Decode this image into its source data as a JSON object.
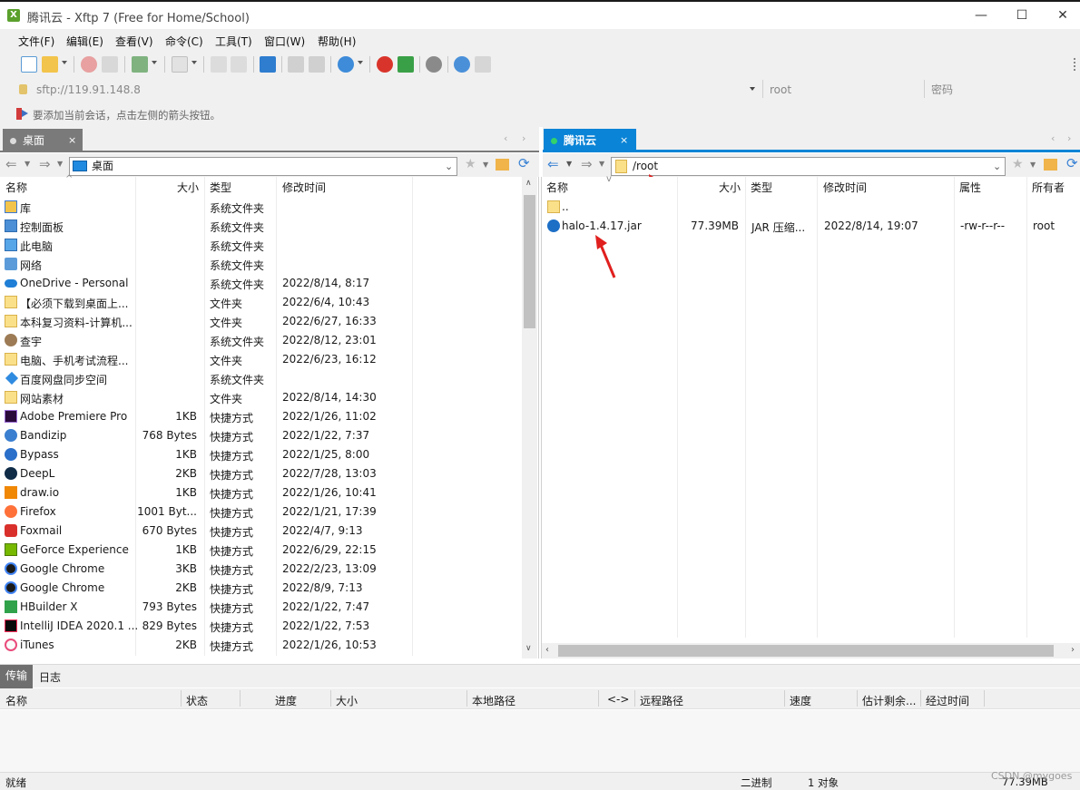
{
  "window": {
    "title": "腾讯云 - Xftp 7 (Free for Home/School)",
    "minimize": "—",
    "maximize": "☐",
    "close": "✕"
  },
  "menu": [
    "文件(F)",
    "编辑(E)",
    "查看(V)",
    "命令(C)",
    "工具(T)",
    "窗口(W)",
    "帮助(H)"
  ],
  "address": {
    "host": "sftp://119.91.148.8",
    "user": "root",
    "password_placeholder": "密码"
  },
  "hint": "要添加当前会话，点击左侧的箭头按钮。",
  "local": {
    "tab_label": "桌面",
    "path": "桌面",
    "columns": [
      "名称",
      "大小",
      "类型",
      "修改时间"
    ],
    "rows": [
      {
        "name": "库",
        "size": "",
        "type": "系统文件夹",
        "modified": "",
        "icon": "library-icon"
      },
      {
        "name": "控制面板",
        "size": "",
        "type": "系统文件夹",
        "modified": "",
        "icon": "control-panel-icon"
      },
      {
        "name": "此电脑",
        "size": "",
        "type": "系统文件夹",
        "modified": "",
        "icon": "computer-icon"
      },
      {
        "name": "网络",
        "size": "",
        "type": "系统文件夹",
        "modified": "",
        "icon": "network-icon"
      },
      {
        "name": "OneDrive - Personal",
        "size": "",
        "type": "系统文件夹",
        "modified": "2022/8/14, 8:17",
        "icon": "cloud-icon"
      },
      {
        "name": "【必须下载到桌面上...",
        "size": "",
        "type": "文件夹",
        "modified": "2022/6/4, 10:43",
        "icon": "folder-icon"
      },
      {
        "name": "本科复习资料-计算机...",
        "size": "",
        "type": "文件夹",
        "modified": "2022/6/27, 16:33",
        "icon": "folder-icon"
      },
      {
        "name": "查宇",
        "size": "",
        "type": "系统文件夹",
        "modified": "2022/8/12, 23:01",
        "icon": "user-folder-icon"
      },
      {
        "name": "电脑、手机考试流程...",
        "size": "",
        "type": "文件夹",
        "modified": "2022/6/23, 16:12",
        "icon": "folder-icon"
      },
      {
        "name": "百度网盘同步空间",
        "size": "",
        "type": "系统文件夹",
        "modified": "",
        "icon": "sync-folder-icon"
      },
      {
        "name": "网站素材",
        "size": "",
        "type": "文件夹",
        "modified": "2022/8/14, 14:30",
        "icon": "folder-icon"
      },
      {
        "name": "Adobe Premiere Pro",
        "size": "1KB",
        "type": "快捷方式",
        "modified": "2022/1/26, 11:02",
        "icon": "premiere-icon"
      },
      {
        "name": "Bandizip",
        "size": "768 Bytes",
        "type": "快捷方式",
        "modified": "2022/1/22, 7:37",
        "icon": "bandizip-icon"
      },
      {
        "name": "Bypass",
        "size": "1KB",
        "type": "快捷方式",
        "modified": "2022/1/25, 8:00",
        "icon": "bypass-icon"
      },
      {
        "name": "DeepL",
        "size": "2KB",
        "type": "快捷方式",
        "modified": "2022/7/28, 13:03",
        "icon": "deepl-icon"
      },
      {
        "name": "draw.io",
        "size": "1KB",
        "type": "快捷方式",
        "modified": "2022/1/26, 10:41",
        "icon": "drawio-icon"
      },
      {
        "name": "Firefox",
        "size": "1001 Byt...",
        "type": "快捷方式",
        "modified": "2022/1/21, 17:39",
        "icon": "firefox-icon"
      },
      {
        "name": "Foxmail",
        "size": "670 Bytes",
        "type": "快捷方式",
        "modified": "2022/4/7, 9:13",
        "icon": "foxmail-icon"
      },
      {
        "name": "GeForce Experience",
        "size": "1KB",
        "type": "快捷方式",
        "modified": "2022/6/29, 22:15",
        "icon": "geforce-icon"
      },
      {
        "name": "Google Chrome",
        "size": "3KB",
        "type": "快捷方式",
        "modified": "2022/2/23, 13:09",
        "icon": "chrome-icon"
      },
      {
        "name": "Google Chrome",
        "size": "2KB",
        "type": "快捷方式",
        "modified": "2022/8/9, 7:13",
        "icon": "chrome-icon"
      },
      {
        "name": "HBuilder X",
        "size": "793 Bytes",
        "type": "快捷方式",
        "modified": "2022/1/22, 7:47",
        "icon": "hbuilder-icon"
      },
      {
        "name": "IntelliJ IDEA 2020.1 ...",
        "size": "829 Bytes",
        "type": "快捷方式",
        "modified": "2022/1/22, 7:53",
        "icon": "intellij-icon"
      },
      {
        "name": "iTunes",
        "size": "2KB",
        "type": "快捷方式",
        "modified": "2022/1/26, 10:53",
        "icon": "itunes-icon"
      }
    ]
  },
  "remote": {
    "tab_label": "腾讯云",
    "path": "/root",
    "columns": [
      "名称",
      "大小",
      "类型",
      "修改时间",
      "属性",
      "所有者"
    ],
    "rows": [
      {
        "name": "..",
        "size": "",
        "type": "",
        "modified": "",
        "attr": "",
        "owner": "",
        "icon": "folder-icon"
      },
      {
        "name": "halo-1.4.17.jar",
        "size": "77.39MB",
        "type": "JAR 压缩...",
        "modified": "2022/8/14, 19:07",
        "attr": "-rw-r--r--",
        "owner": "root",
        "icon": "jar-file-icon"
      }
    ]
  },
  "transfer": {
    "tabs": [
      "传输",
      "日志"
    ],
    "columns": [
      "名称",
      "状态",
      "进度",
      "大小",
      "本地路径",
      "<->",
      "远程路径",
      "速度",
      "估计剩余...",
      "经过时间"
    ]
  },
  "status": {
    "left": "就绪",
    "mode": "二进制",
    "count": "1 对象",
    "size": "77.39MB",
    "watermark": "CSDN @mygoes"
  },
  "colors": {
    "accent": "#0a84d6",
    "panel": "#f0f0f0",
    "arrow": "#e0201e"
  }
}
